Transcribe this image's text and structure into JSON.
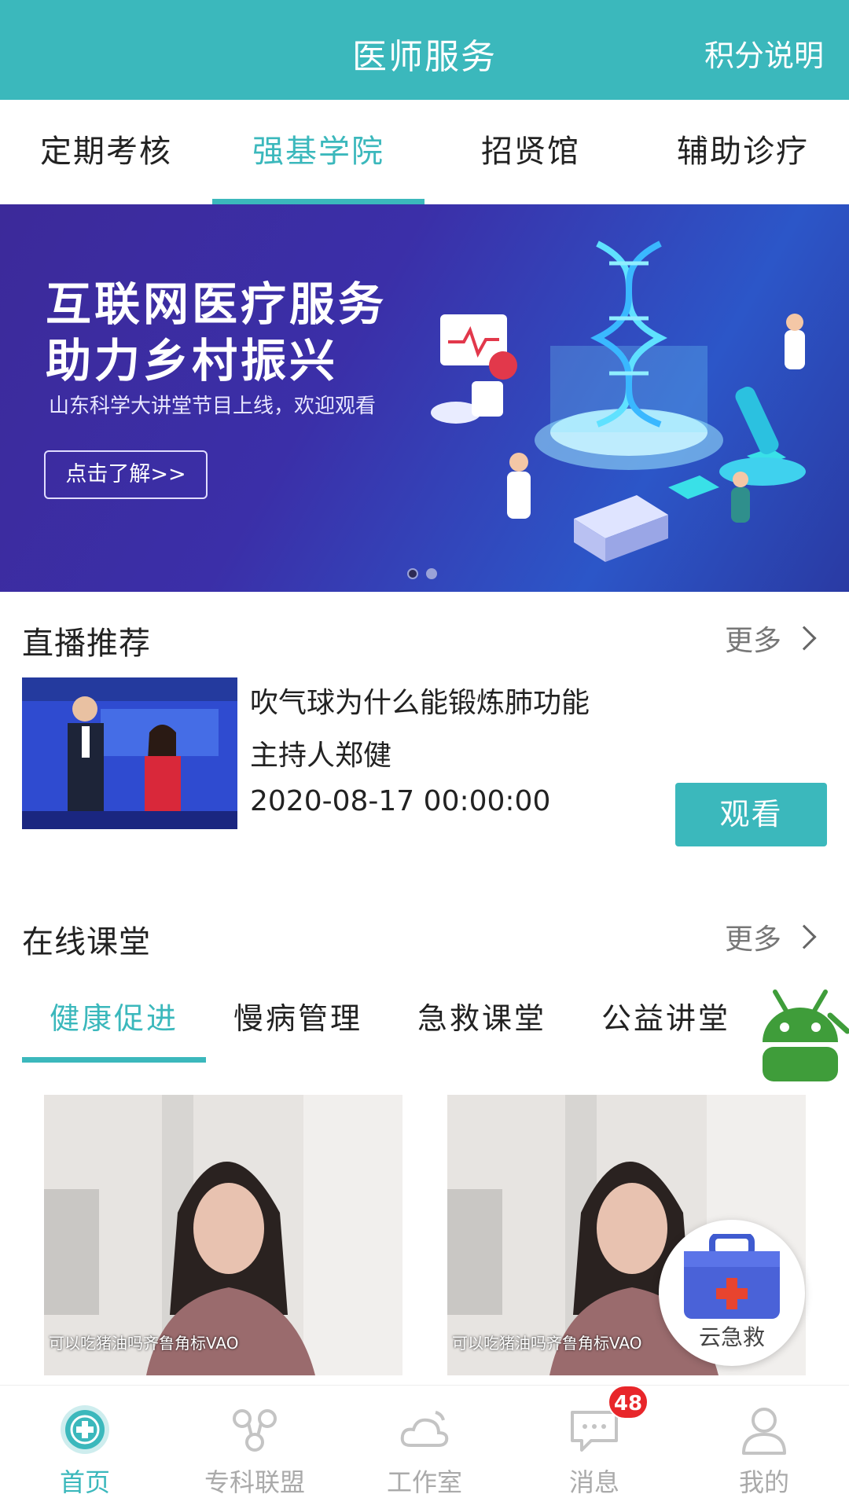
{
  "header": {
    "title": "医师服务",
    "right_action": "积分说明",
    "bg_color": "#3bb8bc"
  },
  "top_tabs": [
    {
      "label": "定期考核",
      "active": false
    },
    {
      "label": "强基学院",
      "active": true
    },
    {
      "label": "招贤馆",
      "active": false
    },
    {
      "label": "辅助诊疗",
      "active": false
    }
  ],
  "banner": {
    "headline_1": "互联网医疗服务",
    "headline_2": "助力乡村振兴",
    "subtitle": "山东科学大讲堂节目上线，欢迎观看",
    "button": "点击了解>>",
    "page_count": 2,
    "active_page": 1
  },
  "live": {
    "section_title": "直播推荐",
    "more": "更多",
    "video_title": "吹气球为什么能锻炼肺功能",
    "host": "主持人郑健",
    "datetime": "2020-08-17 00:00:00",
    "watch_button": "观看"
  },
  "courses": {
    "section_title": "在线课堂",
    "more": "更多",
    "tabs": [
      {
        "label": "健康促进",
        "active": true
      },
      {
        "label": "慢病管理",
        "active": false
      },
      {
        "label": "急救课堂",
        "active": false
      },
      {
        "label": "公益讲堂",
        "active": false
      }
    ],
    "cards": [
      {
        "caption": "可以吃猪油吗齐鲁角标VAO"
      },
      {
        "caption": "可以吃猪油吗齐鲁角标VAO"
      }
    ]
  },
  "fab": {
    "label": "云急救"
  },
  "bottom_nav": {
    "items": [
      {
        "label": "首页",
        "icon": "home-plus-icon",
        "active": true
      },
      {
        "label": "专科联盟",
        "icon": "network-icon",
        "active": false
      },
      {
        "label": "工作室",
        "icon": "cloud-icon",
        "active": false
      },
      {
        "label": "消息",
        "icon": "message-icon",
        "active": false,
        "badge": "48"
      },
      {
        "label": "我的",
        "icon": "user-icon",
        "active": false
      }
    ]
  }
}
